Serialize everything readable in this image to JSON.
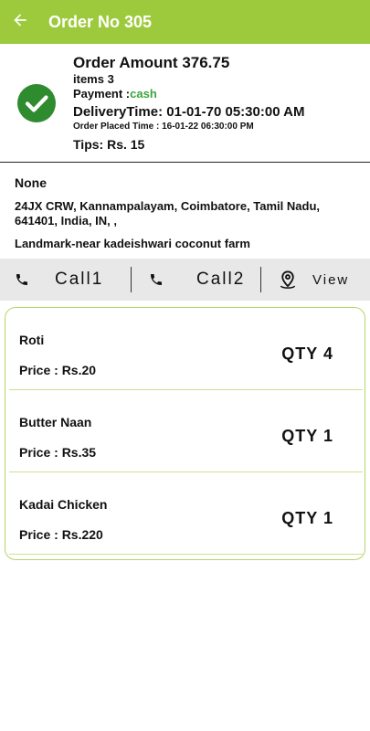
{
  "appbar": {
    "title": "Order No 305",
    "back_icon": "back-arrow-icon",
    "bg_color": "#9dca3c"
  },
  "summary": {
    "status_icon": "check-circle-icon",
    "status_color": "#2e8b2e",
    "amount": "Order Amount 376.75",
    "items": "items 3",
    "payment_label": "Payment :",
    "payment_value": "cash",
    "payment_color": "#3aa63a",
    "delivery_time": "DeliveryTime: 01-01-70 05:30:00 AM",
    "order_placed": "Order Placed Time : 16-01-22 06:30:00 PM",
    "tips": "Tips: Rs. 15"
  },
  "customer": {
    "name": "None",
    "address": "24JX CRW, Kannampalayam, Coimbatore, Tamil Nadu, 641401, India, IN,  ,",
    "landmark": "Landmark-near kadeishwari coconut farm"
  },
  "actions": {
    "call1_icon": "phone-icon",
    "call1_label": "Call1",
    "call2_icon": "phone-icon",
    "call2_label": "Call2",
    "view_icon": "map-pin-icon",
    "view_label": "View"
  },
  "order_items": [
    {
      "name": "Roti",
      "price": "Price : Rs.20",
      "qty": "QTY  4"
    },
    {
      "name": "Butter Naan",
      "price": "Price : Rs.35",
      "qty": "QTY  1"
    },
    {
      "name": "Kadai Chicken",
      "price": "Price : Rs.220",
      "qty": "QTY  1"
    }
  ],
  "theme": {
    "card_border": "#b6d46a",
    "action_bar_bg": "#e8e8e8"
  }
}
